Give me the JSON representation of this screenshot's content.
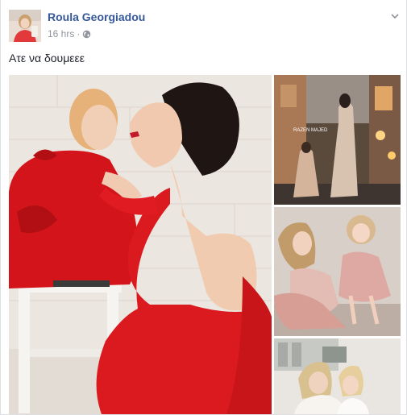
{
  "post": {
    "author": "Roula Georgiadou",
    "timestamp": "16 hrs",
    "separator": "·",
    "privacy_icon": "globe-icon",
    "menu_icon": "chevron-down-icon",
    "caption": "Ατε να δουμεεε"
  },
  "colors": {
    "author_link": "#365899",
    "meta_text": "#90949c",
    "body_text": "#1d2129",
    "accent_red": "#d8121e",
    "border": "#dddfe2"
  },
  "photos": {
    "main": {
      "description_icon": "photo"
    },
    "top_right": {
      "watermark": "RAZEN MAJED"
    },
    "middle_right": {
      "description_icon": "photo"
    },
    "bottom_right": {
      "description_icon": "photo"
    }
  }
}
